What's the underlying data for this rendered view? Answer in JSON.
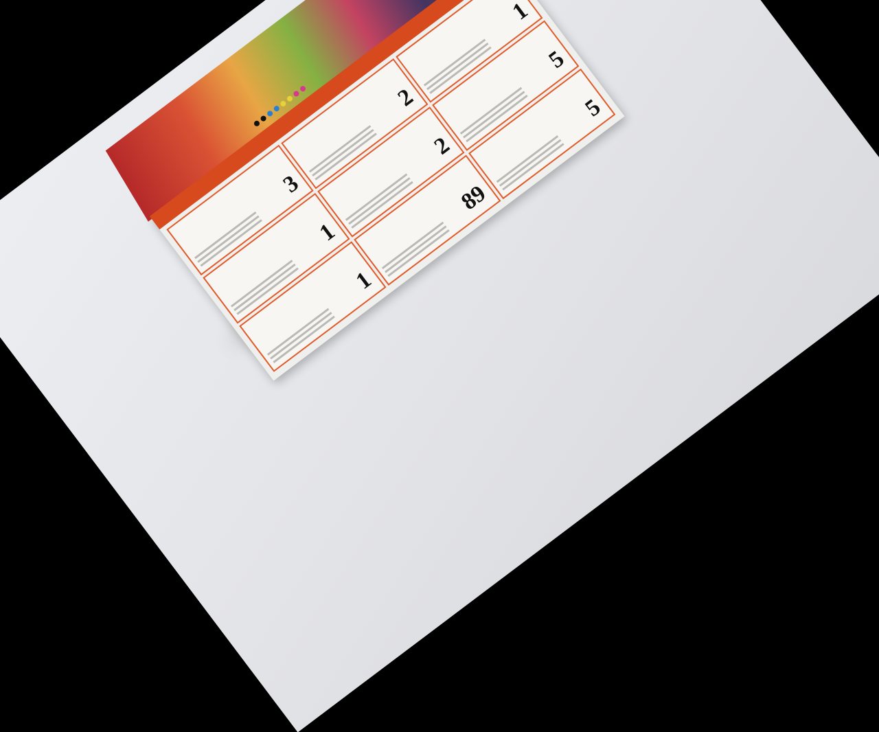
{
  "scene": {
    "subject": "folded grocery store sale flyer lying on a white surface",
    "background_color": "#e6e7ea",
    "accent_color": "#d64a1e"
  },
  "flyer": {
    "ribbon_text": "",
    "items": [
      {
        "name": "",
        "price": "3"
      },
      {
        "name": "",
        "price": "2"
      },
      {
        "name": "",
        "price": "1"
      },
      {
        "name": "",
        "price": "1"
      },
      {
        "name": "",
        "price": "2"
      },
      {
        "name": "",
        "price": "5"
      },
      {
        "name": "",
        "price": "1"
      },
      {
        "name": "",
        "price": "89"
      },
      {
        "name": "",
        "price": "5"
      }
    ]
  }
}
